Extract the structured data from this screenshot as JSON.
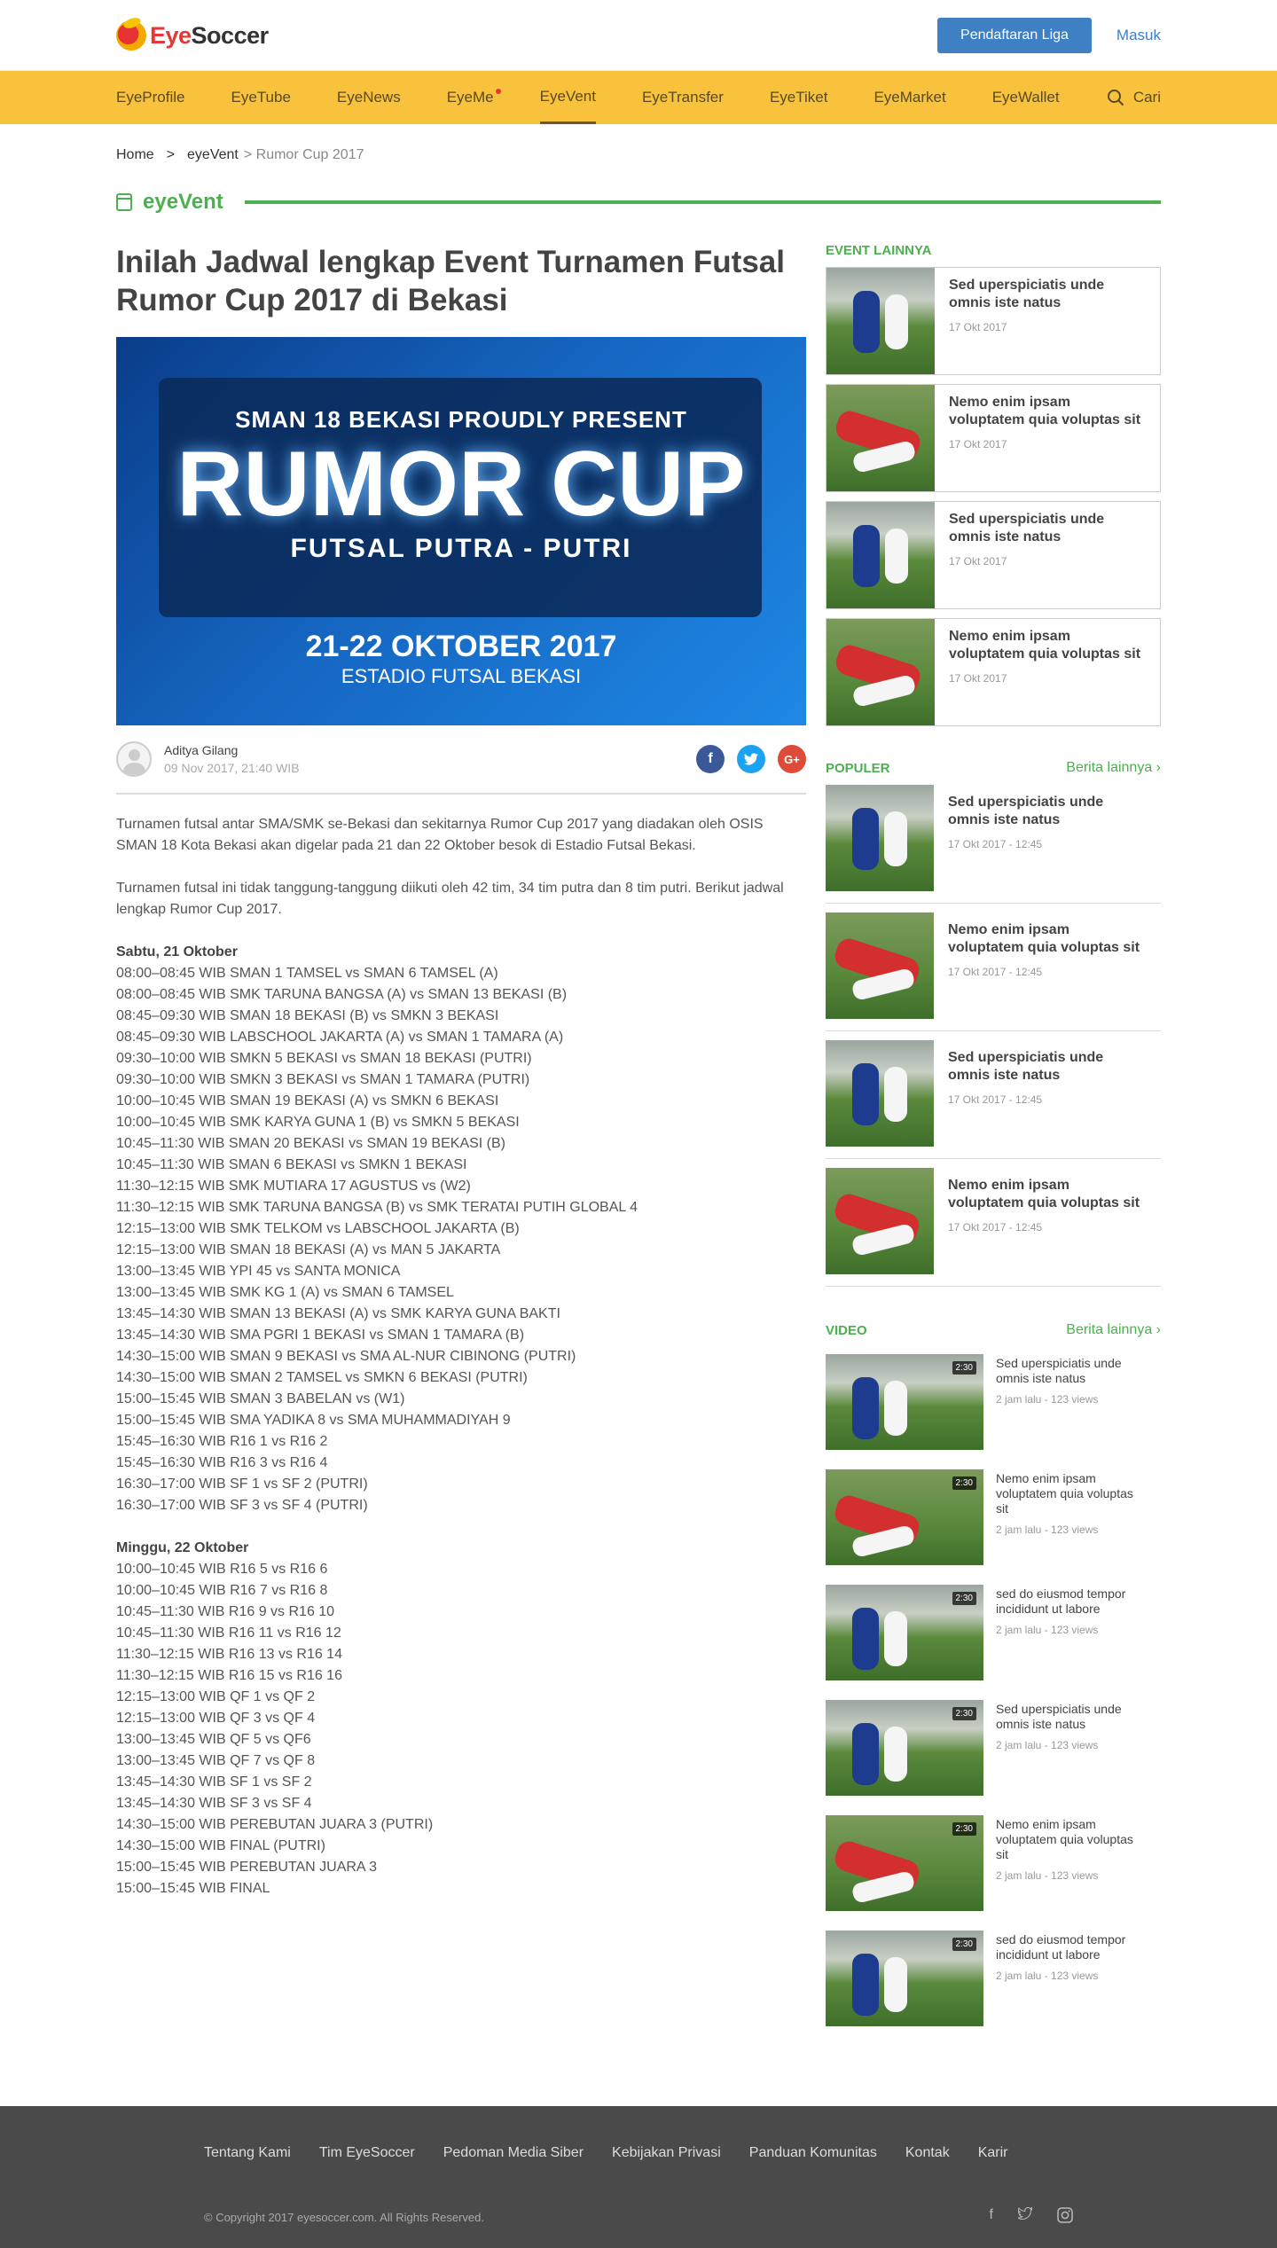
{
  "brand": {
    "logo_prefix": "Eye",
    "logo_suffix": "Soccer"
  },
  "header": {
    "register_label": "Pendaftaran Liga",
    "login_label": "Masuk"
  },
  "nav": {
    "items": [
      "EyeProfile",
      "EyeTube",
      "EyeNews",
      "EyeMe",
      "EyeVent",
      "EyeTransfer",
      "EyeTiket",
      "EyeMarket",
      "EyeWallet"
    ],
    "active": "EyeVent",
    "search_label": "Cari"
  },
  "breadcrumb": {
    "home": "Home",
    "sep": ">",
    "section": "eyeVent",
    "current": "> Rumor Cup 2017"
  },
  "section_title": "eyeVent",
  "article": {
    "title": "Inilah Jadwal lengkap Event Turnamen Futsal Rumor Cup 2017 di Bekasi",
    "hero": {
      "line1": "SMAN 18 BEKASI PROUDLY PRESENT",
      "line2": "RUMOR CUP",
      "line3": "FUTSAL PUTRA - PUTRI",
      "line4": "21-22 OKTOBER 2017",
      "line5": "ESTADIO FUTSAL BEKASI"
    },
    "author": "Aditya Gilang",
    "date": "09 Nov 2017, 21:40 WIB",
    "para1": "Turnamen futsal antar SMA/SMK se-Bekasi dan sekitarnya Rumor Cup 2017 yang diadakan oleh OSIS SMAN 18 Kota Bekasi akan digelar pada 21 dan 22 Oktober besok di Estadio Futsal Bekasi.",
    "para2": "Turnamen futsal ini tidak tanggung-tanggung diikuti oleh 42 tim, 34 tim putra dan 8 tim putri. Berikut jadwal lengkap Rumor Cup 2017.",
    "day1": "Sabtu, 21 Oktober",
    "day1_matches": [
      "08:00–08:45 WIB SMAN 1 TAMSEL vs SMAN 6 TAMSEL (A)",
      "08:00–08:45 WIB SMK TARUNA BANGSA (A) vs SMAN 13 BEKASI (B)",
      "08:45–09:30 WIB SMAN 18 BEKASI (B) vs SMKN 3 BEKASI",
      "08:45–09:30 WIB LABSCHOOL JAKARTA (A) vs SMAN 1 TAMARA (A)",
      "09:30–10:00 WIB SMKN 5 BEKASI vs SMAN 18 BEKASI (PUTRI)",
      "09:30–10:00 WIB SMKN 3 BEKASI vs SMAN 1 TAMARA (PUTRI)",
      "10:00–10:45 WIB SMAN 19 BEKASI (A) vs SMKN 6 BEKASI",
      "10:00–10:45 WIB SMK KARYA GUNA 1 (B) vs SMKN 5 BEKASI",
      "10:45–11:30 WIB SMAN 20 BEKASI vs SMAN 19 BEKASI (B)",
      "10:45–11:30 WIB SMAN 6 BEKASI vs SMKN 1 BEKASI",
      "11:30–12:15 WIB SMK MUTIARA 17 AGUSTUS vs (W2)",
      "11:30–12:15 WIB SMK TARUNA BANGSA (B) vs SMK TERATAI PUTIH GLOBAL 4",
      "12:15–13:00 WIB SMK TELKOM vs LABSCHOOL JAKARTA (B)",
      "12:15–13:00 WIB SMAN 18 BEKASI (A) vs MAN 5 JAKARTA",
      "13:00–13:45 WIB YPI 45 vs SANTA MONICA",
      "13:00–13:45 WIB SMK KG 1 (A) vs SMAN 6 TAMSEL",
      "13:45–14:30 WIB SMAN 13 BEKASI (A) vs SMK KARYA GUNA BAKTI",
      "13:45–14:30 WIB SMA PGRI 1 BEKASI vs SMAN 1 TAMARA (B)",
      "14:30–15:00 WIB SMAN 9 BEKASI vs SMA AL-NUR CIBINONG (PUTRI)",
      "14:30–15:00 WIB SMAN 2 TAMSEL vs SMKN 6 BEKASI (PUTRI)",
      "15:00–15:45 WIB SMAN 3 BABELAN vs (W1)",
      "15:00–15:45 WIB SMA YADIKA 8 vs SMA MUHAMMADIYAH 9",
      "15:45–16:30 WIB R16 1 vs R16 2",
      "15:45–16:30 WIB R16 3 vs R16 4",
      "16:30–17:00 WIB SF 1 vs SF 2 (PUTRI)",
      "16:30–17:00 WIB SF 3 vs SF 4 (PUTRI)"
    ],
    "day2": "Minggu, 22 Oktober",
    "day2_matches": [
      "10:00–10:45 WIB R16 5 vs R16 6",
      "10:00–10:45 WIB R16 7 vs R16 8",
      "10:45–11:30 WIB R16 9 vs R16 10",
      "10:45–11:30 WIB R16 11 vs R16 12",
      "11:30–12:15 WIB R16 13 vs R16 14",
      "11:30–12:15 WIB R16 15 vs R16 16",
      "12:15–13:00 WIB QF 1 vs QF 2",
      "12:15–13:00 WIB QF 3 vs QF 4",
      "13:00–13:45 WIB QF 5 vs QF6",
      "13:00–13:45 WIB QF 7 vs QF 8",
      "13:45–14:30 WIB SF 1 vs SF 2",
      "13:45–14:30 WIB SF 3 vs SF 4",
      "14:30–15:00 WIB PEREBUTAN JUARA 3 (PUTRI)",
      "14:30–15:00 WIB FINAL (PUTRI)",
      "15:00–15:45 WIB PEREBUTAN JUARA 3",
      "15:00–15:45 WIB FINAL"
    ]
  },
  "sidebar": {
    "event_heading": "EVENT LAINNYA",
    "events": [
      {
        "title": "Sed uperspiciatis unde omnis iste natus",
        "date": "17 Okt 2017"
      },
      {
        "title": "Nemo enim ipsam voluptatem quia voluptas sit",
        "date": "17 Okt 2017"
      },
      {
        "title": "Sed uperspiciatis unde omnis iste natus",
        "date": "17 Okt 2017"
      },
      {
        "title": "Nemo enim ipsam voluptatem quia voluptas sit",
        "date": "17 Okt 2017"
      }
    ],
    "popular_heading": "POPULER",
    "more_label": "Berita lainnya",
    "popular": [
      {
        "title": "Sed uperspiciatis unde omnis iste natus",
        "date": "17 Okt 2017 - 12:45"
      },
      {
        "title": "Nemo enim ipsam voluptatem quia voluptas sit",
        "date": "17 Okt 2017 - 12:45"
      },
      {
        "title": "Sed uperspiciatis unde omnis iste natus",
        "date": "17 Okt 2017 - 12:45"
      },
      {
        "title": "Nemo enim ipsam voluptatem quia voluptas sit",
        "date": "17 Okt 2017 - 12:45"
      }
    ],
    "video_heading": "VIDEO",
    "videos": [
      {
        "title": "Sed uperspiciatis unde omnis iste natus",
        "meta": "2 jam lalu - 123 views",
        "duration": "2:30"
      },
      {
        "title": "Nemo enim ipsam voluptatem quia voluptas sit",
        "meta": "2 jam lalu - 123 views",
        "duration": "2:30"
      },
      {
        "title": "sed do eiusmod tempor incididunt ut labore",
        "meta": "2 jam lalu - 123 views",
        "duration": "2:30"
      },
      {
        "title": "Sed uperspiciatis unde omnis iste natus",
        "meta": "2 jam lalu - 123 views",
        "duration": "2:30"
      },
      {
        "title": "Nemo enim ipsam voluptatem quia voluptas sit",
        "meta": "2 jam lalu - 123 views",
        "duration": "2:30"
      },
      {
        "title": "sed do eiusmod tempor incididunt ut labore",
        "meta": "2 jam lalu - 123 views",
        "duration": "2:30"
      }
    ]
  },
  "footer": {
    "links": [
      "Tentang Kami",
      "Tim EyeSoccer",
      "Pedoman Media Siber",
      "Kebijakan Privasi",
      "Panduan Komunitas",
      "Kontak",
      "Karir"
    ],
    "copyright": "© Copyright 2017 eyesoccer.com. All Rights Reserved."
  },
  "colors": {
    "nav_bg": "#f8c23c",
    "accent_green": "#4caf50",
    "primary_blue": "#3f7fc4",
    "footer_bg": "#4a4a4a"
  },
  "icons": [
    "search-icon",
    "calendar-icon",
    "facebook-icon",
    "twitter-icon",
    "google-plus-icon",
    "chevron-right-icon",
    "instagram-icon"
  ]
}
